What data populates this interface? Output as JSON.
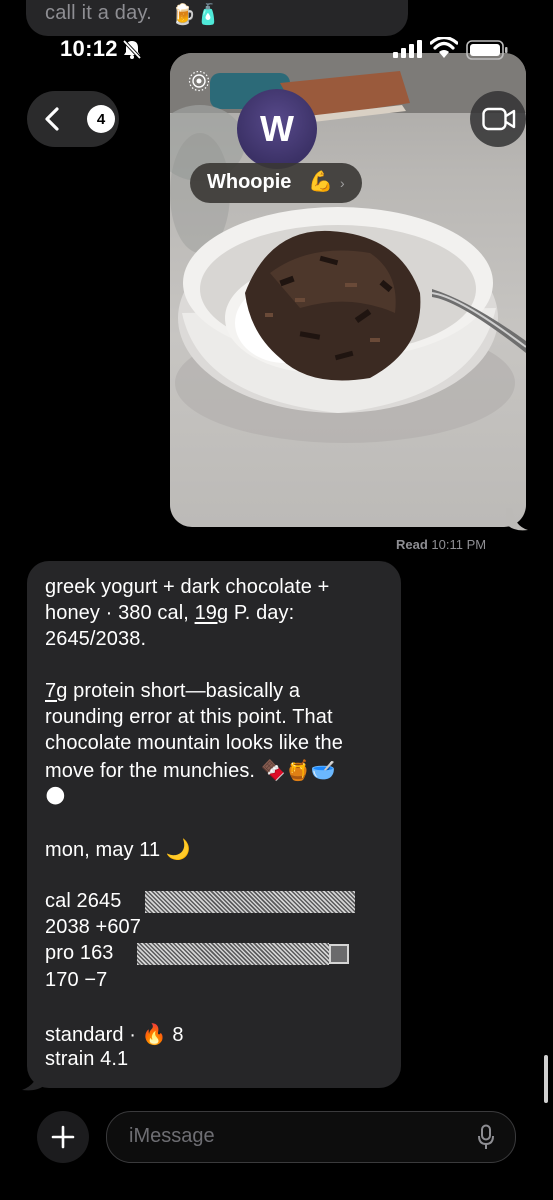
{
  "previous_message": {
    "text": "call it a day.",
    "emoji": "🍺🧴"
  },
  "status_bar": {
    "time": "10:12"
  },
  "header": {
    "back_badge": "4",
    "avatar_initial": "W",
    "contact_name": "Whoopie",
    "contact_emoji": "💪",
    "chevron": "›"
  },
  "read_receipt": {
    "label": "Read",
    "time": "10:11 PM"
  },
  "reply": {
    "l1": "greek yogurt + dark chocolate +",
    "l2a": "honey · 380 cal, ",
    "l2u": "19g",
    "l2b": " P. day:",
    "l3": "2645/2038.",
    "l4u": "7g",
    "l4b": " protein short—basically a",
    "l5": "rounding error at this point. That",
    "l6": "chocolate mountain looks like the",
    "l7": "move for the munchies. 🍫🍯🥣",
    "l8": "🌑",
    "date_line": "mon, may 11 🌙",
    "cal_label": "cal 2645",
    "cal_detail": "2038  +607",
    "pro_label": "pro 163",
    "pro_detail": "170   −7",
    "standard_line": "standard · 🔥 8",
    "strain_line": "strain 4.1"
  },
  "compose": {
    "placeholder": "iMessage"
  },
  "colors": {
    "bubble": "#262628",
    "secondary_text": "#8e8e93",
    "avatar": "#4a3f7a"
  },
  "icons": [
    "bell-slash-icon",
    "signal-icon",
    "wifi-icon",
    "battery-icon",
    "chevron-left-icon",
    "video-camera-icon",
    "live-photo-icon",
    "plus-icon",
    "microphone-icon"
  ]
}
